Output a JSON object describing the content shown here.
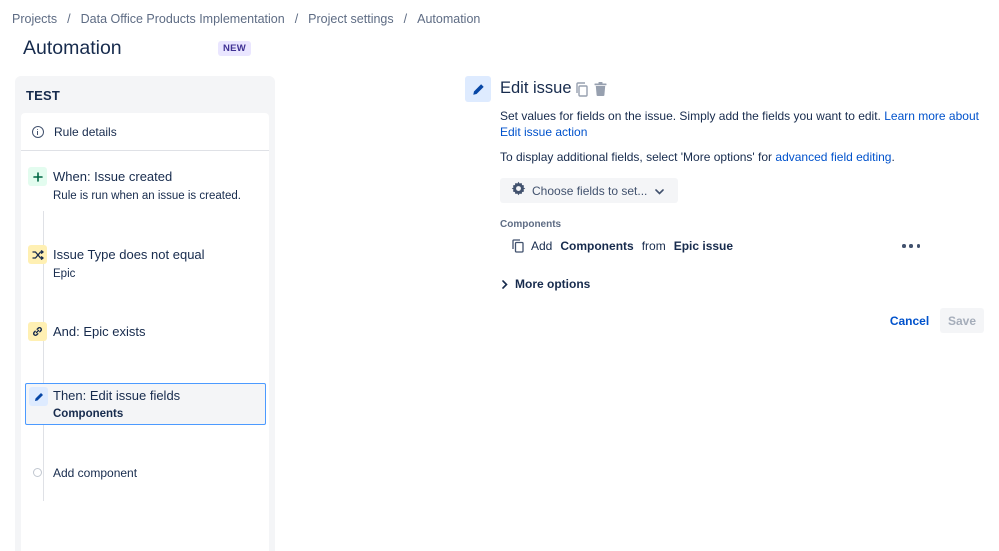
{
  "breadcrumb": {
    "items": [
      "Projects",
      "Data Office Products Implementation",
      "Project settings",
      "Automation"
    ],
    "separator": "/"
  },
  "page": {
    "title": "Automation",
    "badge": "NEW"
  },
  "rule": {
    "name": "TEST",
    "details_label": "Rule details",
    "components": [
      {
        "type": "trigger",
        "icon": "plus-icon",
        "title": "When: Issue created",
        "subtitle": "Rule is run when an issue is created."
      },
      {
        "type": "condition",
        "icon": "shuffle-icon",
        "title": "Issue Type does not equal",
        "subtitle": "Epic"
      },
      {
        "type": "branch",
        "icon": "link-icon",
        "title": "And: Epic exists"
      },
      {
        "type": "action",
        "icon": "pencil-icon",
        "title": "Then: Edit issue fields",
        "subtitle": "Components",
        "selected": true
      }
    ],
    "add_component_label": "Add component"
  },
  "detail": {
    "title": "Edit issue",
    "description": "Set values for fields on the issue. Simply add the fields you want to edit. ",
    "learn_more_link": "Learn more about Edit issue action",
    "additional_prefix": "To display additional fields, select 'More options' for ",
    "advanced_link": "advanced field editing",
    "additional_suffix": ".",
    "choose_fields_label": "Choose fields to set...",
    "components_heading": "Components",
    "field_value": {
      "prefix": "Add",
      "field": "Components",
      "middle": "from",
      "source": "Epic issue"
    },
    "more_options_label": "More options",
    "cancel_label": "Cancel",
    "save_label": "Save"
  },
  "colors": {
    "link": "#0052CC",
    "selected_border": "#4C9AFF",
    "trigger_bg": "#E3FCEF",
    "condition_bg": "#FFF0B3",
    "action_bg": "#DEEBFF",
    "badge_bg": "#EAE6FF"
  }
}
